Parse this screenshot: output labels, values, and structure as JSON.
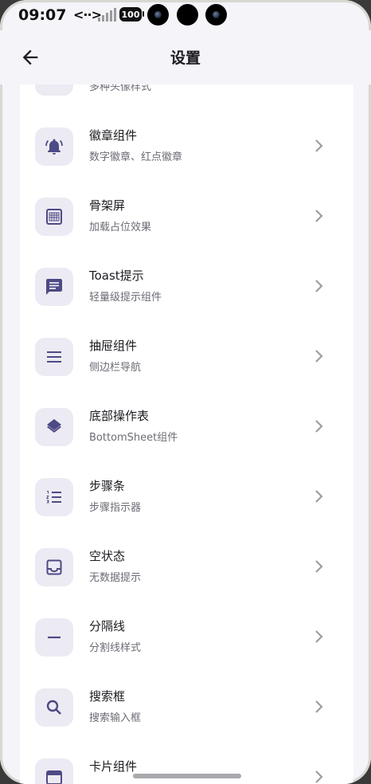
{
  "status": {
    "time": "09:07",
    "network": "<··>",
    "battery": "100"
  },
  "appbar": {
    "title": "设置"
  },
  "items": [
    {
      "title": "",
      "subtitle": "多种头像样式",
      "icon": "avatar-icon"
    },
    {
      "title": "徽章组件",
      "subtitle": "数字徽章、红点徽章",
      "icon": "bell-alert-icon"
    },
    {
      "title": "骨架屏",
      "subtitle": "加载占位效果",
      "icon": "skeleton-grid-icon"
    },
    {
      "title": "Toast提示",
      "subtitle": "轻量级提示组件",
      "icon": "message-icon"
    },
    {
      "title": "抽屉组件",
      "subtitle": "侧边栏导航",
      "icon": "menu-icon"
    },
    {
      "title": "底部操作表",
      "subtitle": "BottomSheet组件",
      "icon": "layers-icon"
    },
    {
      "title": "步骤条",
      "subtitle": "步骤指示器",
      "icon": "numbered-list-icon"
    },
    {
      "title": "空状态",
      "subtitle": "无数据提示",
      "icon": "inbox-icon"
    },
    {
      "title": "分隔线",
      "subtitle": "分割线样式",
      "icon": "divider-icon"
    },
    {
      "title": "搜索框",
      "subtitle": "搜索输入框",
      "icon": "search-icon"
    },
    {
      "title": "卡片组件",
      "subtitle": "",
      "icon": "card-icon"
    }
  ],
  "colors": {
    "icon": "#4e4a85",
    "icon_bg": "#ecebf3",
    "page_bg": "#f5f4f9",
    "card_bg": "#ffffff"
  }
}
